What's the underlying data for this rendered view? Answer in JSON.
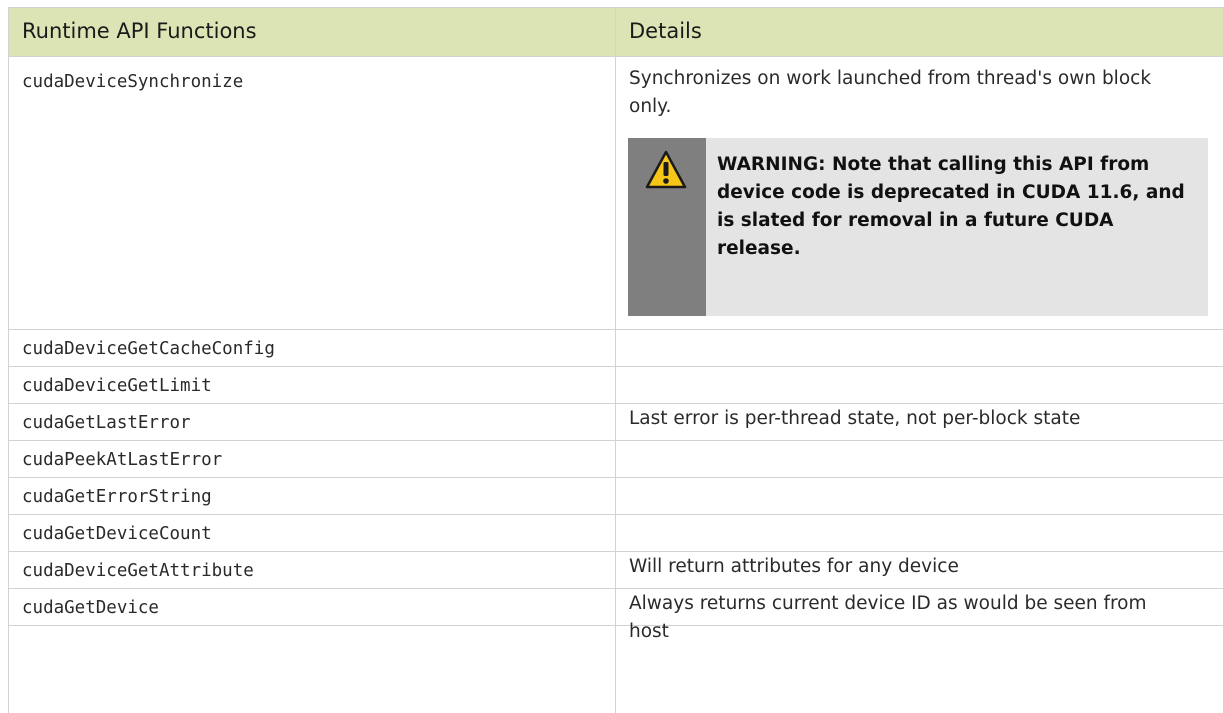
{
  "table": {
    "headers": {
      "functions": "Runtime API Functions",
      "details": "Details"
    },
    "rows": [
      {
        "api": "cudaDeviceSynchronize",
        "details": "Synchronizes on work launched from thread's own block only."
      },
      {
        "api": "cudaDeviceGetCacheConfig",
        "details": ""
      },
      {
        "api": "cudaDeviceGetLimit",
        "details": ""
      },
      {
        "api": "cudaGetLastError",
        "details": "Last error is per-thread state, not per-block state"
      },
      {
        "api": "cudaPeekAtLastError",
        "details": ""
      },
      {
        "api": "cudaGetErrorString",
        "details": ""
      },
      {
        "api": "cudaGetDeviceCount",
        "details": ""
      },
      {
        "api": "cudaDeviceGetAttribute",
        "details": "Will return attributes for any device"
      },
      {
        "api": "cudaGetDevice",
        "details": "Always returns current device ID as would be seen from host"
      }
    ],
    "warning": {
      "text": "WARNING: Note that calling this API from device code is deprecated in CUDA 11.6, and is slated for removal in a future CUDA release.",
      "icon": "warning-triangle-icon"
    }
  },
  "colors": {
    "header_bg": "#dce4b5",
    "warning_bg": "#e4e4e4",
    "warning_bar": "#7f7f7f",
    "warning_icon": "#f5c518"
  }
}
